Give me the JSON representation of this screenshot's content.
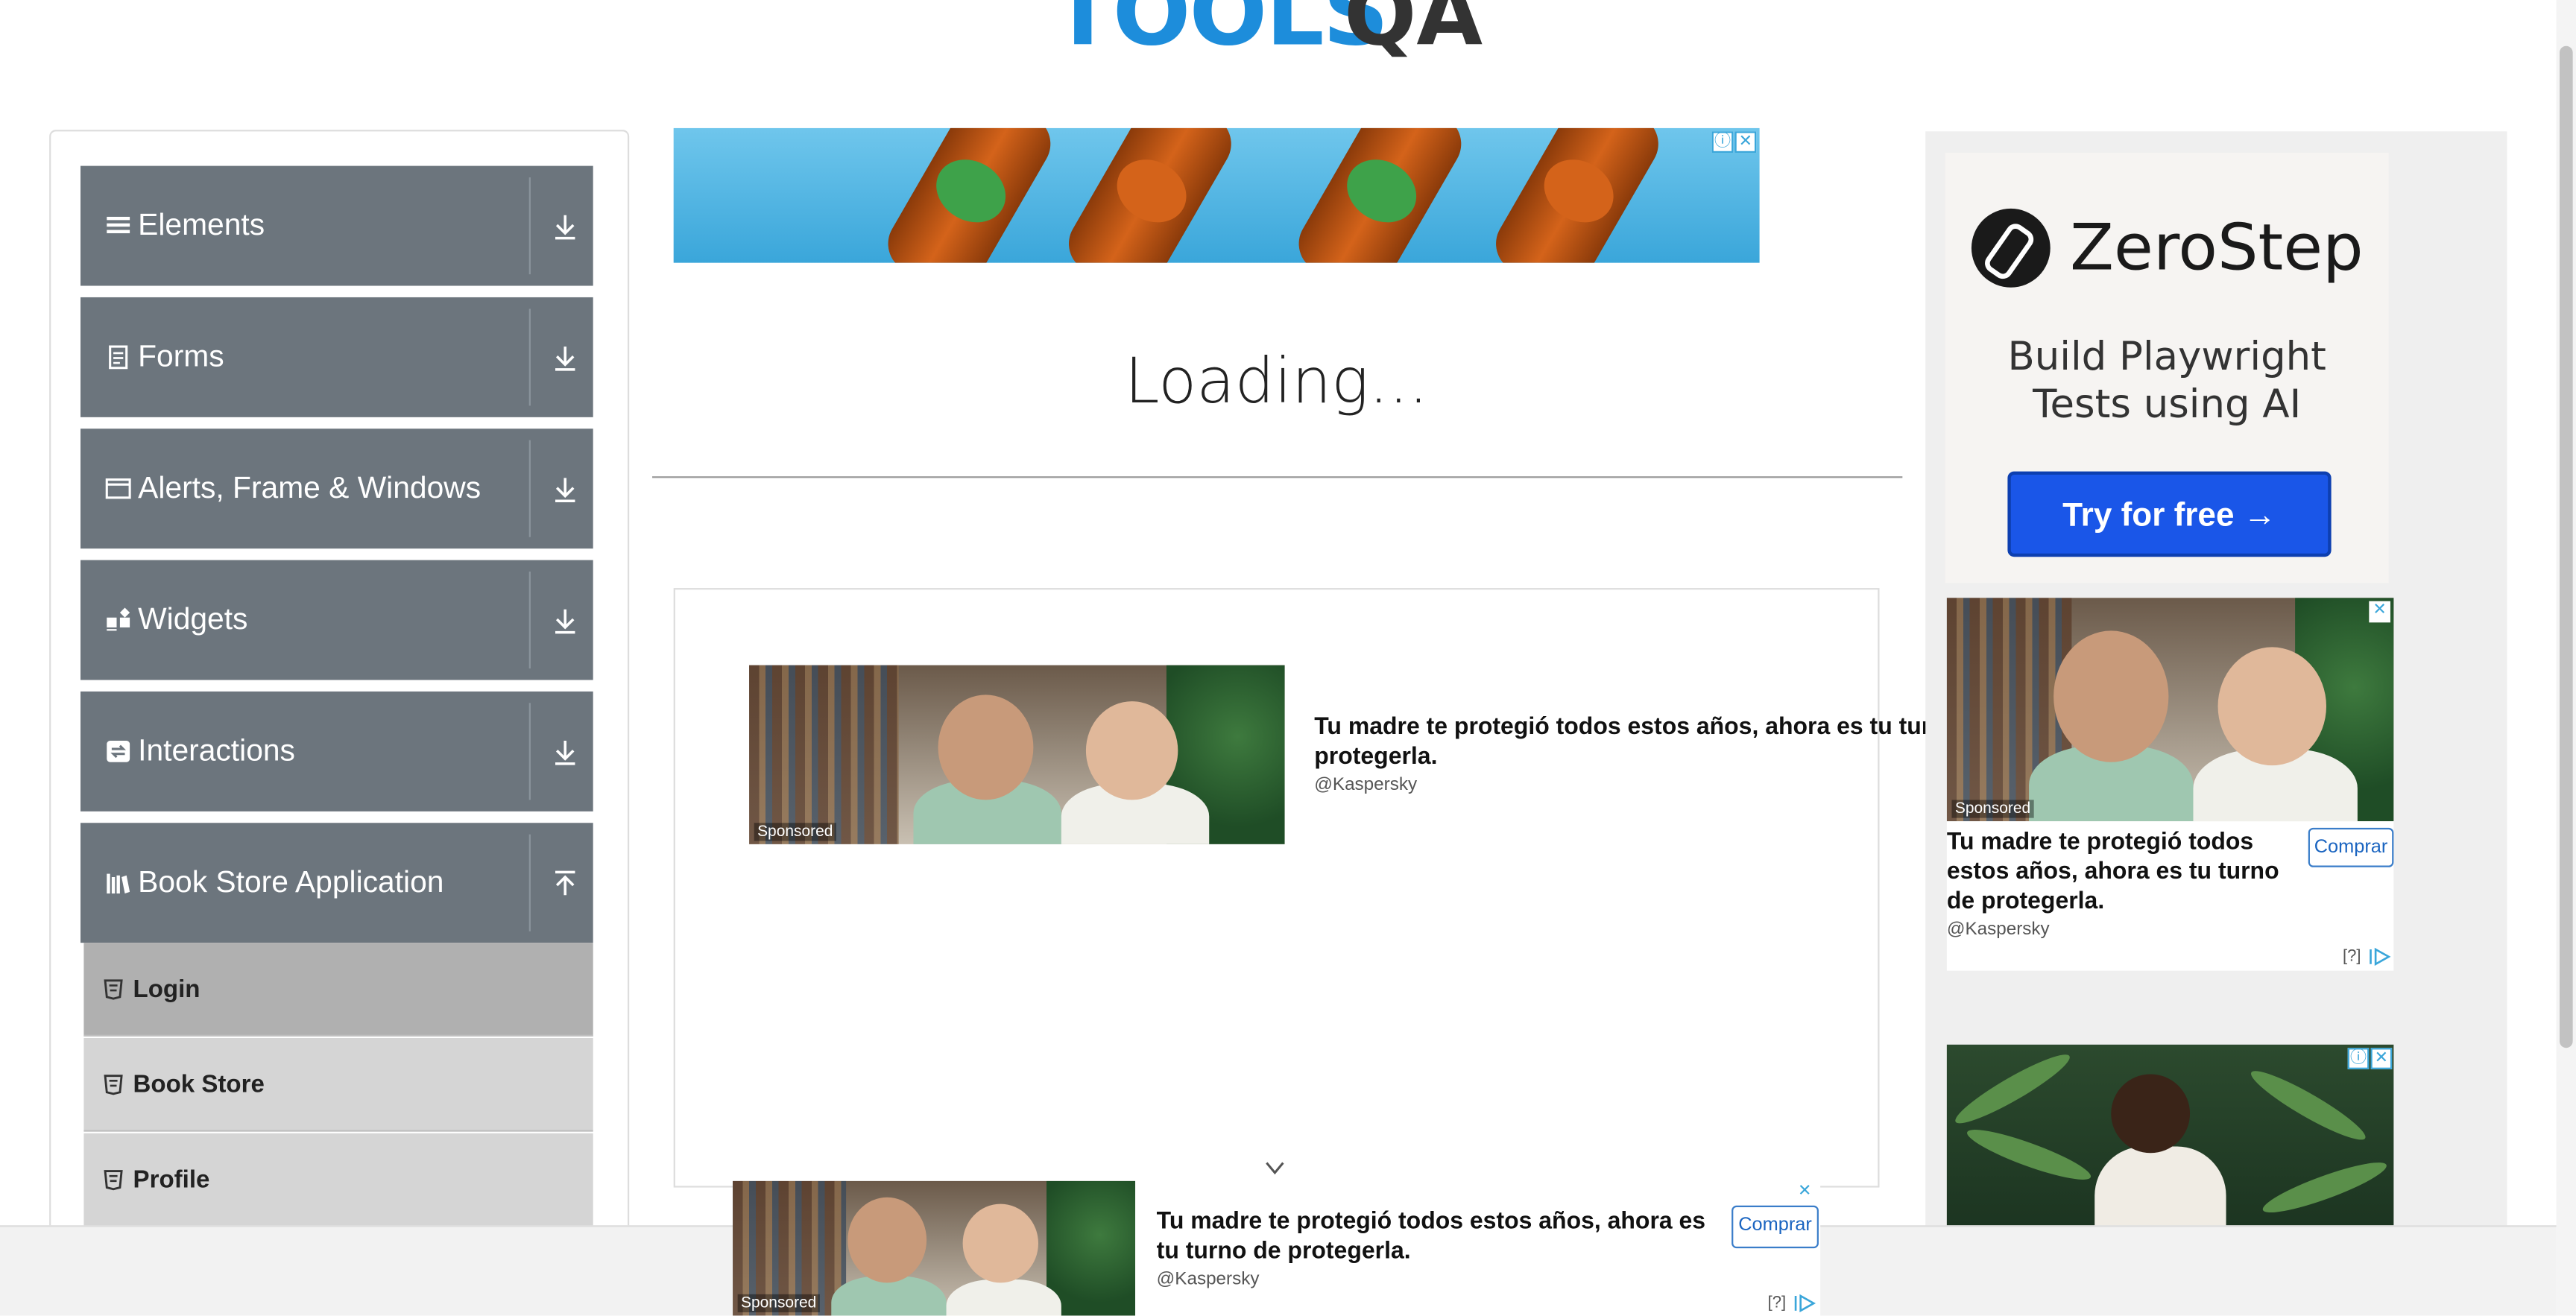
{
  "logo": {
    "text": "TOOLS",
    "suffix": "QA"
  },
  "sidebar": {
    "groups": [
      {
        "label": "Elements",
        "icon": "list-icon",
        "arrow": "download-arrow-icon"
      },
      {
        "label": "Forms",
        "icon": "form-icon",
        "arrow": "download-arrow-icon"
      },
      {
        "label": "Alerts, Frame & Windows",
        "icon": "window-icon",
        "arrow": "download-arrow-icon"
      },
      {
        "label": "Widgets",
        "icon": "widgets-icon",
        "arrow": "download-arrow-icon"
      },
      {
        "label": "Interactions",
        "icon": "interactions-icon",
        "arrow": "download-arrow-icon"
      },
      {
        "label": "Book Store Application",
        "icon": "books-icon",
        "arrow": "upload-arrow-icon"
      }
    ],
    "book_store_items": [
      {
        "label": "Login",
        "active": true
      },
      {
        "label": "Book Store",
        "active": false
      },
      {
        "label": "Profile",
        "active": false
      }
    ]
  },
  "main": {
    "loading": "Loading..."
  },
  "ads": {
    "kaspersky_headline": "Tu madre te protegió todos estos años, ahora es tu turno de protegerla.",
    "kaspersky_headline_wide_1": "Tu madre te protegió todos estos años, ahora es tu turno de",
    "kaspersky_headline_wide_2": "protegerla.",
    "kaspersky_headline_side_1": "Tu madre te protegió todos",
    "kaspersky_headline_side_2": "estos años, ahora es tu turno",
    "kaspersky_headline_side_3": "de protegerla.",
    "kaspersky_headline_bottom_1": "Tu madre te protegió todos estos años, ahora es",
    "kaspersky_headline_bottom_2": "tu turno de protegerla.",
    "handle": "@Kaspersky",
    "sponsored": "Sponsored",
    "buy": "Comprar",
    "help": "[?]",
    "zerostep": {
      "brand": "ZeroStep",
      "tagline_1": "Build Playwright",
      "tagline_2": "Tests using AI",
      "cta": "Try for free →"
    },
    "colors": {
      "zerostep_cta": "#1a56e8",
      "sidebar_group": "#6c757d",
      "logo_blue": "#1d8ddb"
    }
  }
}
